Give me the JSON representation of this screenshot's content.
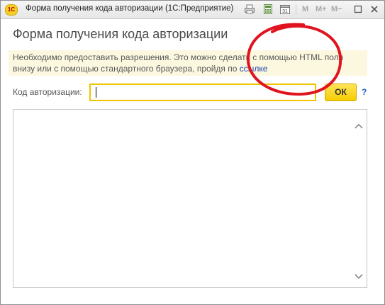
{
  "window": {
    "app_logo_text": "1С",
    "title": "Форма получения кода авторизации  (1С:Предприятие)",
    "toolbar": {
      "m_label": "M",
      "m_plus_label": "M+",
      "m_minus_label": "M−",
      "calendar_day": "31"
    }
  },
  "form": {
    "title": "Форма получения кода авторизации",
    "info_text": "Необходимо предоставить разрешения. Это можно сделать с помощью HTML поля внизу или с помощью стандартного браузера, пройдя по ",
    "info_link": "ссылке",
    "code_label": "Код авторизации:",
    "code_value": "",
    "ok_label": "ОК",
    "help_label": "?"
  },
  "colors": {
    "accent_yellow": "#f5cc00",
    "info_background": "#fcf8e0",
    "link_blue": "#1b42a8",
    "annotation_red": "#e0141e"
  }
}
